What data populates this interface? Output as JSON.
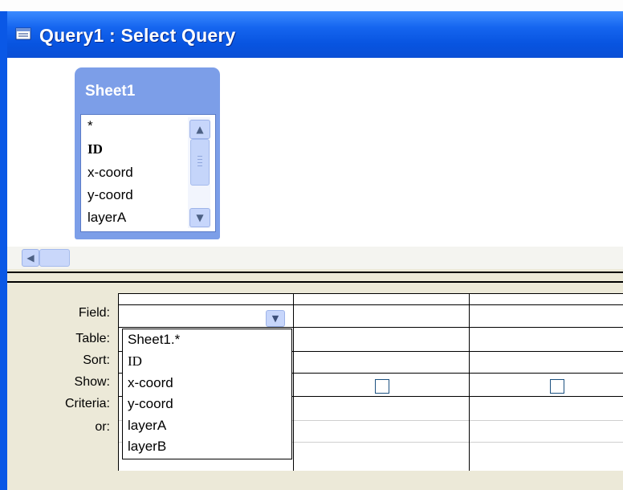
{
  "window": {
    "title": "Query1 : Select Query",
    "title_icon": "query-window-icon",
    "colors": {
      "titlebar": "#0a58e6",
      "table_window": "#7c9ee8",
      "pane": "#ece9d8"
    }
  },
  "table_window": {
    "title": "Sheet1",
    "fields": [
      "*",
      "ID",
      "x-coord",
      "y-coord",
      "layerA"
    ],
    "scroll_up_icon": "chevron-up-icon",
    "scroll_down_icon": "chevron-down-icon"
  },
  "upper_pane": {
    "scroll_left_icon": "chevron-left-icon"
  },
  "design_grid": {
    "row_labels": [
      "Field:",
      "Table:",
      "Sort:",
      "Show:",
      "Criteria:",
      "or:"
    ],
    "field_dropdown_icon": "chevron-down-icon",
    "show_checkboxes_checked": [
      false,
      false
    ]
  },
  "field_dropdown": {
    "options": [
      "Sheet1.*",
      "ID",
      "x-coord",
      "y-coord",
      "layerA",
      "layerB"
    ]
  }
}
